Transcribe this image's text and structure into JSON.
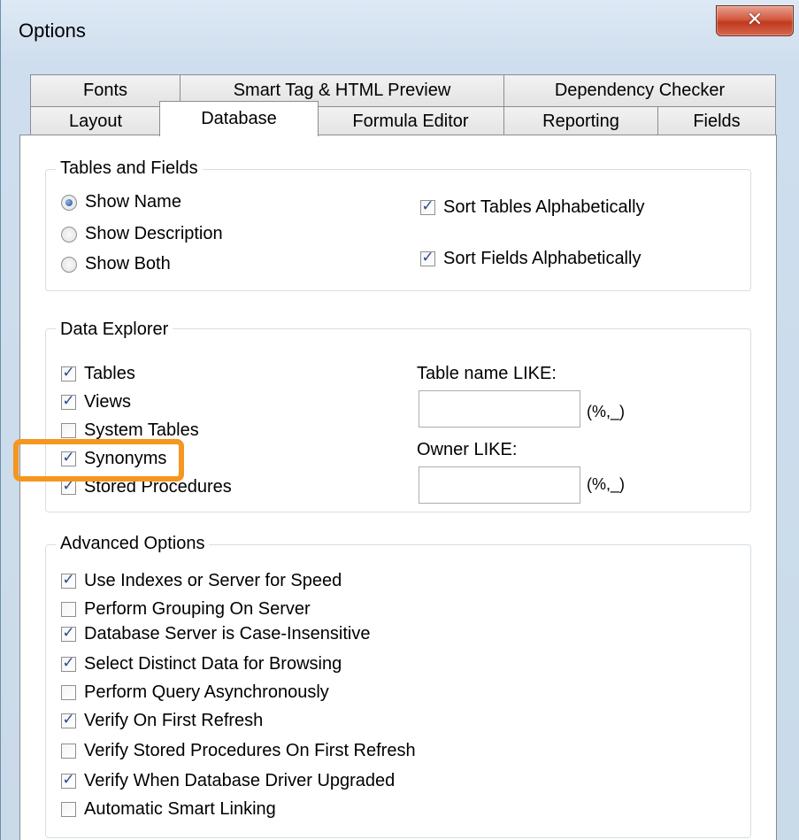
{
  "window": {
    "title": "Options",
    "close_icon": "close-icon"
  },
  "tabs_back": [
    {
      "label": "Fonts"
    },
    {
      "label": "Smart Tag & HTML Preview"
    },
    {
      "label": "Dependency Checker"
    }
  ],
  "tabs_front": [
    {
      "label": "Layout"
    },
    {
      "label": "Database",
      "active": true
    },
    {
      "label": "Formula Editor"
    },
    {
      "label": "Reporting"
    },
    {
      "label": "Fields"
    }
  ],
  "tables_fields": {
    "title": "Tables and Fields",
    "radios": [
      {
        "label": "Show Name",
        "selected": true
      },
      {
        "label": "Show Description",
        "selected": false
      },
      {
        "label": "Show Both",
        "selected": false
      }
    ],
    "checks": [
      {
        "label": "Sort Tables Alphabetically",
        "checked": true
      },
      {
        "label": "Sort Fields Alphabetically",
        "checked": true
      }
    ]
  },
  "data_explorer": {
    "title": "Data Explorer",
    "checks": [
      {
        "label": "Tables",
        "checked": true
      },
      {
        "label": "Views",
        "checked": true
      },
      {
        "label": "System Tables",
        "checked": false
      },
      {
        "label": "Synonyms",
        "checked": true
      },
      {
        "label": "Stored Procedures",
        "checked": true
      }
    ],
    "table_name_label": "Table name LIKE:",
    "table_name_value": "",
    "table_name_hint": "(%,_)",
    "owner_label": "Owner LIKE:",
    "owner_value": "",
    "owner_hint": "(%,_)"
  },
  "advanced": {
    "title": "Advanced Options",
    "checks": [
      {
        "label": "Use Indexes or Server for Speed",
        "checked": true
      },
      {
        "label": "Perform Grouping On Server",
        "checked": false
      },
      {
        "label": "Database Server is Case-Insensitive",
        "checked": true
      },
      {
        "label": "Select Distinct Data for Browsing",
        "checked": true
      },
      {
        "label": "Perform Query Asynchronously",
        "checked": false
      },
      {
        "label": "Verify On First Refresh",
        "checked": true
      },
      {
        "label": "Verify Stored Procedures On First Refresh",
        "checked": false
      },
      {
        "label": "Verify When Database Driver Upgraded",
        "checked": true
      },
      {
        "label": "Automatic Smart Linking",
        "checked": false
      }
    ]
  },
  "highlight_color": "#f5961f"
}
